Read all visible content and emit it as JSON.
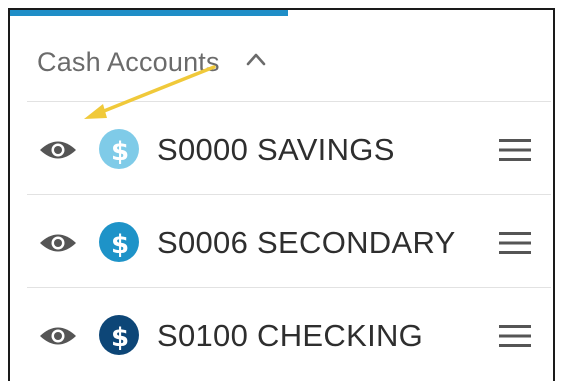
{
  "section": {
    "title": "Cash Accounts",
    "expanded": true
  },
  "colors": {
    "progress": "#1f8ec7",
    "arrow": "#f0c93a",
    "icon_gray": "#555555"
  },
  "accounts": [
    {
      "label": "S0000 SAVINGS",
      "icon": "dollar-coin-icon",
      "coin_color": "#7fcbe8"
    },
    {
      "label": "S0006 SECONDARY",
      "icon": "dollar-coin-icon",
      "coin_color": "#1e93c8"
    },
    {
      "label": "S0100 CHECKING",
      "icon": "dollar-coin-icon",
      "coin_color": "#0d4677"
    }
  ]
}
